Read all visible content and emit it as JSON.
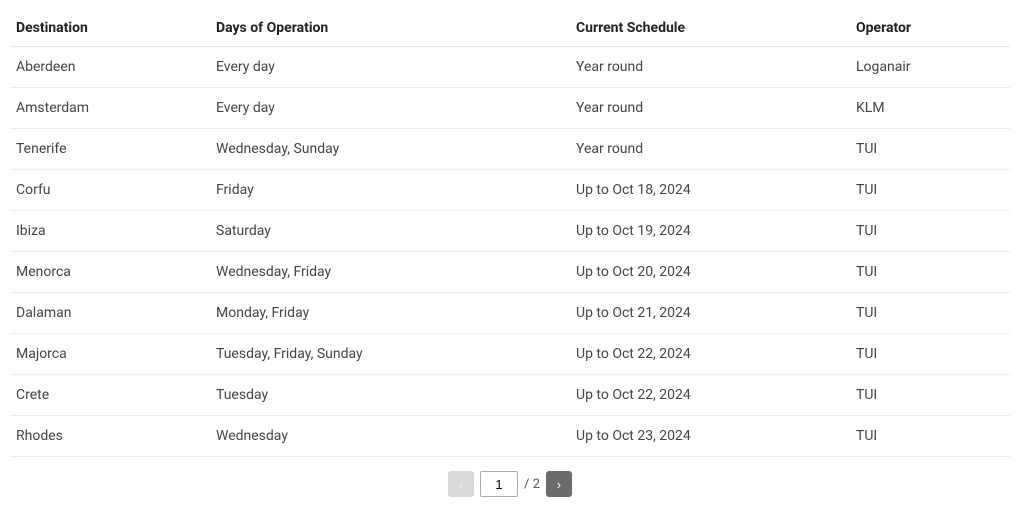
{
  "table": {
    "headers": {
      "destination": "Destination",
      "days": "Days of Operation",
      "schedule": "Current Schedule",
      "operator": "Operator"
    },
    "rows": [
      {
        "destination": "Aberdeen",
        "days": "Every day",
        "schedule": "Year round",
        "operator": "Loganair"
      },
      {
        "destination": "Amsterdam",
        "days": "Every day",
        "schedule": "Year round",
        "operator": "KLM"
      },
      {
        "destination": "Tenerife",
        "days": "Wednesday, Sunday",
        "schedule": "Year round",
        "operator": "TUI"
      },
      {
        "destination": "Corfu",
        "days": "Friday",
        "schedule": "Up to Oct 18, 2024",
        "operator": "TUI"
      },
      {
        "destination": "Ibiza",
        "days": "Saturday",
        "schedule": "Up to Oct 19, 2024",
        "operator": "TUI"
      },
      {
        "destination": "Menorca",
        "days": "Wednesday, Friday",
        "schedule": "Up to Oct 20, 2024",
        "operator": "TUI"
      },
      {
        "destination": "Dalaman",
        "days": "Monday, Friday",
        "schedule": "Up to Oct 21, 2024",
        "operator": "TUI"
      },
      {
        "destination": "Majorca",
        "days": "Tuesday, Friday, Sunday",
        "schedule": "Up to Oct 22, 2024",
        "operator": "TUI"
      },
      {
        "destination": "Crete",
        "days": "Tuesday",
        "schedule": "Up to Oct 22, 2024",
        "operator": "TUI"
      },
      {
        "destination": "Rhodes",
        "days": "Wednesday",
        "schedule": "Up to Oct 23, 2024",
        "operator": "TUI"
      }
    ]
  },
  "pagination": {
    "prev_label": "‹",
    "next_label": "›",
    "current_page": "1",
    "total_pages": "2",
    "separator": "/"
  }
}
